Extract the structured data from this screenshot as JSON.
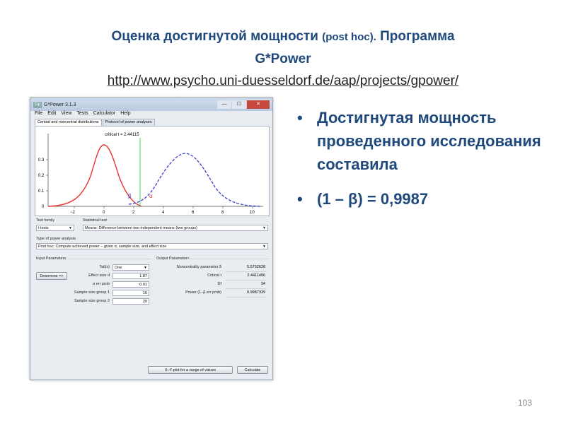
{
  "slide": {
    "title_line1_a": "Оценка достигнутой мощности",
    "title_line1_b": "(post hoc).",
    "title_line1_c": "Программа",
    "title_line2": "G*Power",
    "title_url": "http://www.psycho.uni-duesseldorf.de/aap/projects/gpower/",
    "bullets": [
      "Достигнутая мощность проведенного исследования составила",
      "(1 – β) = 0,9987"
    ],
    "bullet_glyph": "•",
    "page_number": "103",
    "colors": {
      "title": "#1f497d",
      "bullet_text": "#1f497d",
      "red_curve": "#e8322c",
      "blue_curve": "#3a3fd0",
      "critical_line": "#33cc33"
    }
  },
  "gpower": {
    "window_title": "G*Power 3.1.3",
    "app_icon_text": "Gp",
    "window_buttons": {
      "minimize": "—",
      "maximize": "☐",
      "close": "✕"
    },
    "menu": [
      "File",
      "Edit",
      "View",
      "Tests",
      "Calculator",
      "Help"
    ],
    "tabs": [
      "Central and noncentral distributions",
      "Protocol of power analyses"
    ],
    "plot": {
      "critical_label": "critical t =  2.44115",
      "beta_label": "β",
      "alpha_label": "α",
      "y_ticks": [
        "0.3",
        "0.2",
        "0.1",
        "0"
      ],
      "x_ticks": [
        "−2",
        "0",
        "2",
        "4",
        "6",
        "8",
        "10"
      ]
    },
    "test_family_label": "Test family",
    "test_family_value": "t tests",
    "statistical_test_label": "Statistical test",
    "statistical_test_value": "Means: Difference between two independent means (two groups)",
    "type_label": "Type of power analysis",
    "type_value": "Post hoc: Compute achieved power – given α, sample size, and effect size",
    "input_header": "Input Parameters",
    "output_header": "Output Parameters",
    "determine_button": "Determine =>",
    "inputs": [
      {
        "label": "Tail(s)",
        "value": "One"
      },
      {
        "label": "Effect size d",
        "value": "1.87"
      },
      {
        "label": "α err prob",
        "value": "0.01"
      },
      {
        "label": "Sample size group 1",
        "value": "16"
      },
      {
        "label": "Sample size group 2",
        "value": "20"
      }
    ],
    "outputs": [
      {
        "label": "Noncentrality parameter δ",
        "value": "5.5752628"
      },
      {
        "label": "Critical t",
        "value": "2.4411496"
      },
      {
        "label": "Df",
        "value": "34"
      },
      {
        "label": "Power (1–β err prob)",
        "value": "0.9987339"
      }
    ],
    "xy_plot_button": "X–Y plot for a range of values",
    "calculate_button": "Calculate",
    "combo_arrow": "▼"
  }
}
